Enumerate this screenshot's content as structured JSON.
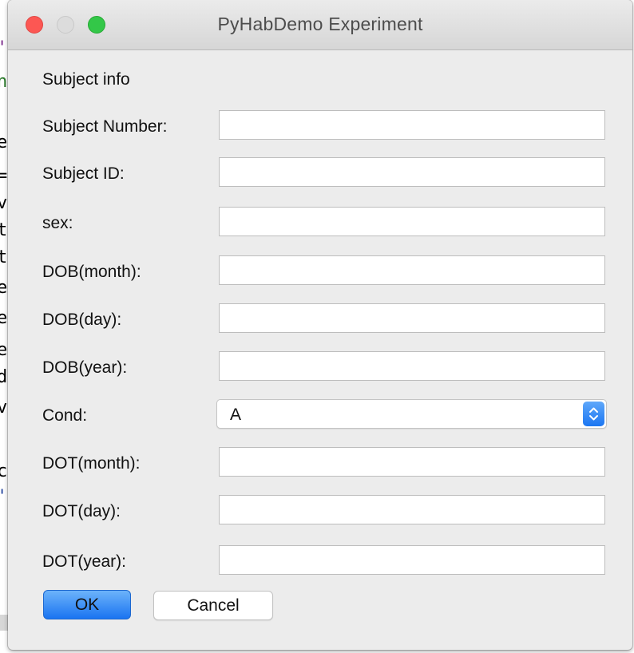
{
  "window": {
    "title": "PyHabDemo Experiment"
  },
  "form": {
    "heading": "Subject info",
    "fields": [
      {
        "label": "Subject Number:",
        "value": ""
      },
      {
        "label": "Subject ID:",
        "value": ""
      },
      {
        "label": "sex:",
        "value": ""
      },
      {
        "label": "DOB(month):",
        "value": ""
      },
      {
        "label": "DOB(day):",
        "value": ""
      },
      {
        "label": "DOB(year):",
        "value": ""
      }
    ],
    "cond": {
      "label": "Cond:",
      "selected": "A"
    },
    "fields2": [
      {
        "label": "DOT(month):",
        "value": ""
      },
      {
        "label": "DOT(day):",
        "value": ""
      },
      {
        "label": "DOT(year):",
        "value": ""
      }
    ]
  },
  "buttons": {
    "ok_label": "OK",
    "cancel_label": "Cancel"
  },
  "colors": {
    "accent": "#1a74f1",
    "close": "#fc5753",
    "maximize": "#33c748"
  }
}
